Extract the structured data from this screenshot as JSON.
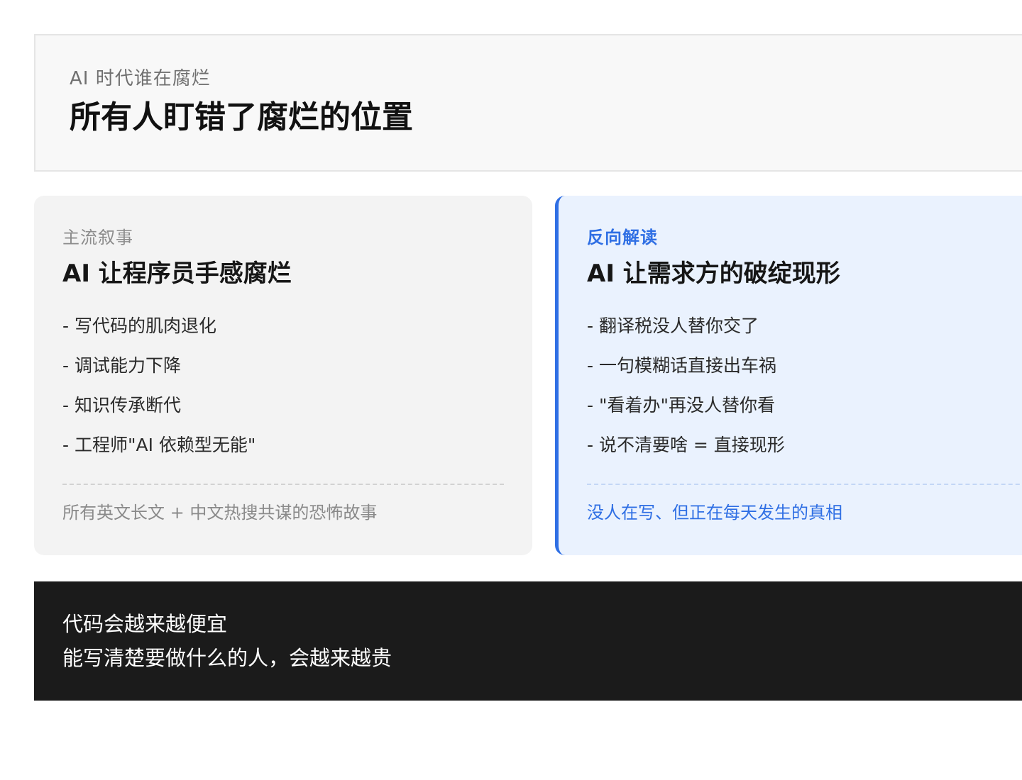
{
  "header": {
    "kicker": "AI 时代谁在腐烂",
    "title": "所有人盯错了腐烂的位置"
  },
  "left_card": {
    "kicker": "主流叙事",
    "title": "AI 让程序员手感腐烂",
    "items": [
      "- 写代码的肌肉退化",
      "- 调试能力下降",
      "- 知识传承断代",
      "- 工程师\"AI 依赖型无能\""
    ],
    "footer": "所有英文长文 + 中文热搜共谋的恐怖故事"
  },
  "right_card": {
    "kicker": "反向解读",
    "title": "AI 让需求方的破绽现形",
    "items": [
      "- 翻译税没人替你交了",
      "- 一句模糊话直接出车祸",
      "- \"看着办\"再没人替你看",
      "- 说不清要啥 = 直接现形"
    ],
    "footer": "没人在写、但正在每天发生的真相"
  },
  "banner": {
    "line1": "代码会越来越便宜",
    "line2": "能写清楚要做什么的人，会越来越贵"
  },
  "colors": {
    "accent": "#2f6fe4",
    "left_card_bg": "#f3f3f3",
    "right_card_bg": "#eaf2fe",
    "banner_bg": "#1b1b1b"
  }
}
